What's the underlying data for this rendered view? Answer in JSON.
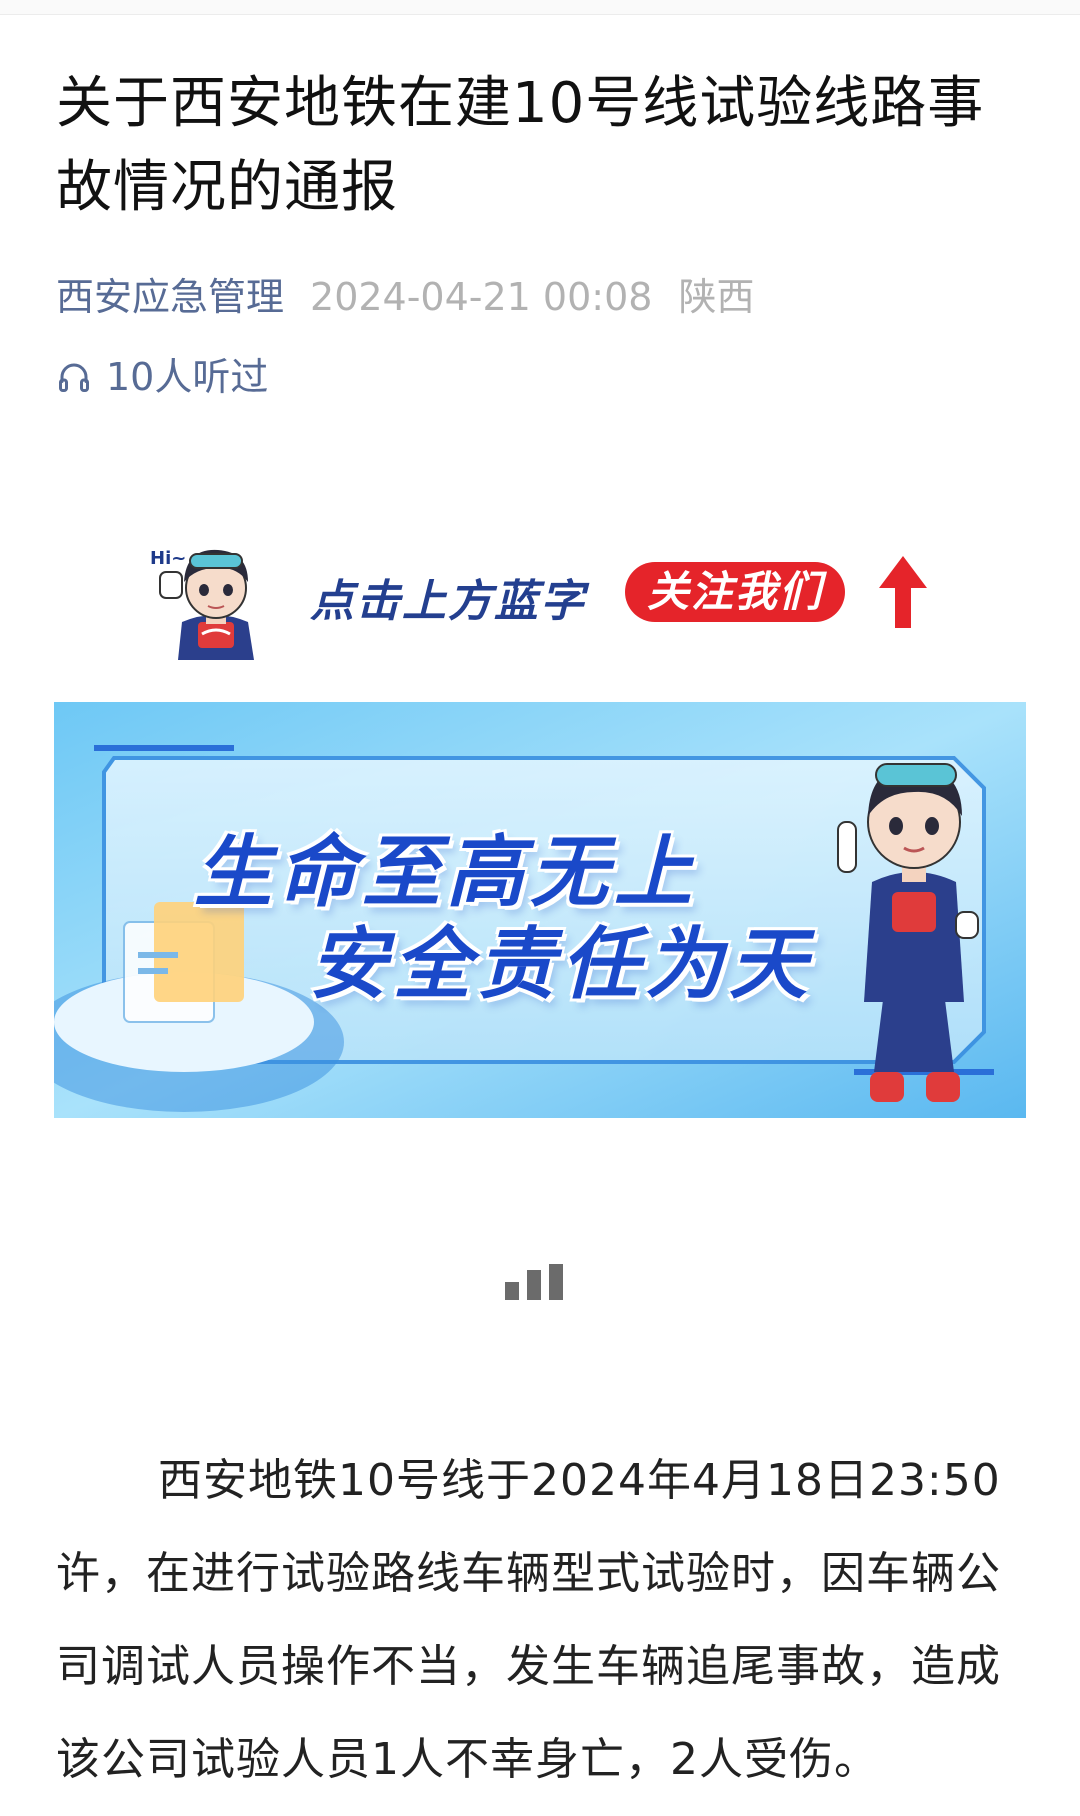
{
  "article": {
    "title": "关于西安地铁在建10号线试验线路事故情况的通报",
    "account": "西安应急管理",
    "date": "2024-04-21 00:08",
    "region": "陕西",
    "listen_count": "10人听过"
  },
  "follow_banner": {
    "hi": "Hi~",
    "text": "点击上方蓝字",
    "button": "关注我们"
  },
  "safety_banner": {
    "line1": "生命至高无上",
    "line2": "安全责任为天"
  },
  "body": {
    "paragraph": "西安地铁10号线于2024年4月18日23:50许，在进行试验路线车辆型式试验时，因车辆公司调试人员操作不当，发生车辆追尾事故，造成该公司试验人员1人不幸身亡，2人受伤。"
  },
  "colors": {
    "link": "#576b95",
    "muted": "#b2b2b2",
    "accent_red": "#e5242a",
    "banner_blue": "#1a49c9"
  }
}
